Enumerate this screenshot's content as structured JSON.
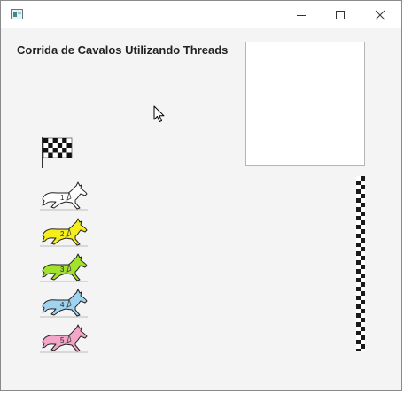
{
  "window": {
    "title": "",
    "icon": "java-app-icon",
    "controls": {
      "minimize": "minimize-icon",
      "maximize": "maximize-icon",
      "close": "close-icon"
    }
  },
  "main": {
    "heading": "Corrida de Cavalos Utilizando Threads",
    "info_box_text": "",
    "start_flag": "checkered-flag-icon",
    "finish_line": "checkered-finish-line",
    "horses": [
      {
        "number": "1",
        "color": "#ffffff"
      },
      {
        "number": "2",
        "color": "#f5ee1a"
      },
      {
        "number": "3",
        "color": "#a3e22a"
      },
      {
        "number": "4",
        "color": "#9fd3ef"
      },
      {
        "number": "5",
        "color": "#f3a6c8"
      }
    ]
  }
}
